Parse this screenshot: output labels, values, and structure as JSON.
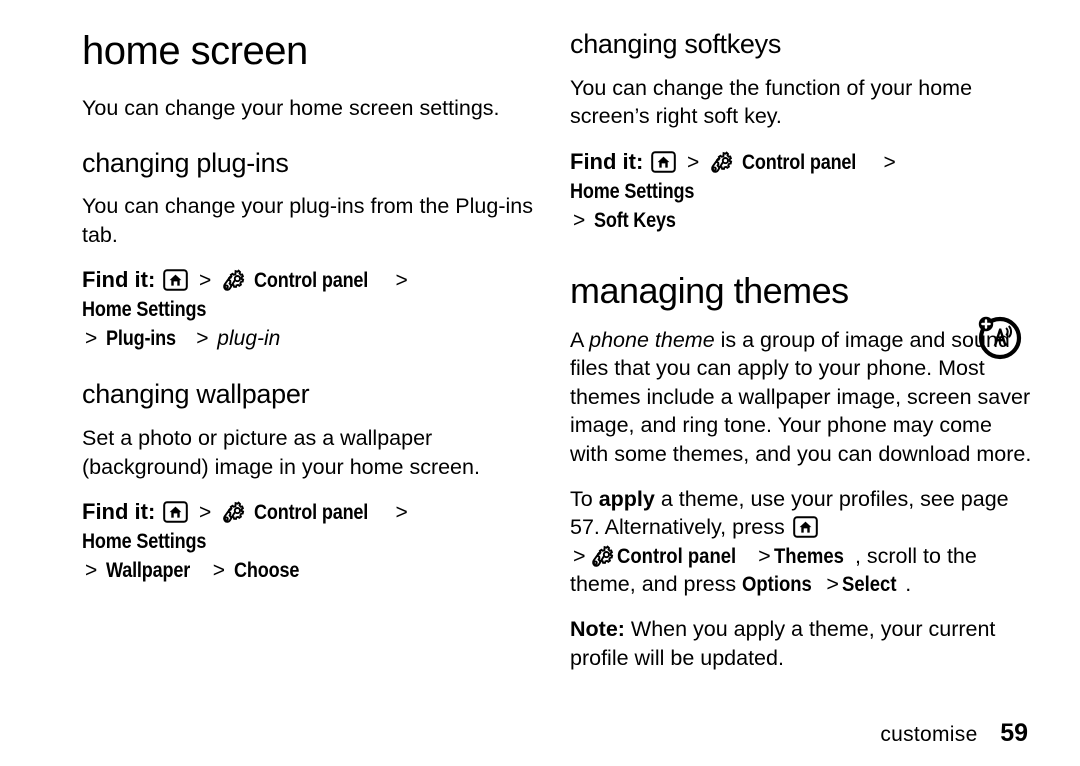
{
  "document": {
    "background_color": "#ffffff",
    "text_color": "#000000"
  },
  "left_column": {
    "chapter_title": "home screen",
    "intro": "You can change your home screen settings.",
    "sections": [
      {
        "title": "changing plug-ins",
        "body": "You can change your plug-ins from the Plug-ins tab.",
        "findit": {
          "label": "Find it:",
          "steps": [
            "Control panel",
            "Home Settings",
            "Plug-ins"
          ],
          "final_italic": "plug-in"
        }
      },
      {
        "title": "changing wallpaper",
        "body": "Set a photo or picture as a wallpaper (background) image in your home screen.",
        "findit": {
          "label": "Find it:",
          "steps": [
            "Control panel",
            "Home Settings",
            "Wallpaper",
            "Choose"
          ]
        }
      }
    ]
  },
  "right_column": {
    "softkeys": {
      "title": "changing softkeys",
      "body": "You can change the function of your home screen’s right soft key.",
      "findit": {
        "label": "Find it:",
        "steps": [
          "Control panel",
          "Home Settings",
          "Soft Keys"
        ]
      }
    },
    "themes": {
      "title": "managing themes",
      "paragraph1_a": "A ",
      "paragraph1_em": "phone theme",
      "paragraph1_b": " is a group of image and sound files that you can apply to your phone. Most themes include a wallpaper image, screen saver image, and ring tone. Your phone may come with some themes, and you can download more.",
      "paragraph2_a": "To ",
      "paragraph2_bold1": "apply",
      "paragraph2_b": " a theme, use your profiles, see page 57. Alternatively, press ",
      "paragraph2_nav1": "Control panel",
      "paragraph2_nav2": "Themes",
      "paragraph2_c": ", scroll to the theme, and press ",
      "paragraph2_nav3": "Options",
      "paragraph2_nav4": "Select",
      "paragraph2_d": ".",
      "note_label": "Note:",
      "note_body": " When you apply a theme, your current profile will be updated."
    },
    "margin_icon_name": "note-tip-antenna-icon"
  },
  "separator": ">",
  "footer": {
    "section": "customise",
    "page_number": "59"
  }
}
